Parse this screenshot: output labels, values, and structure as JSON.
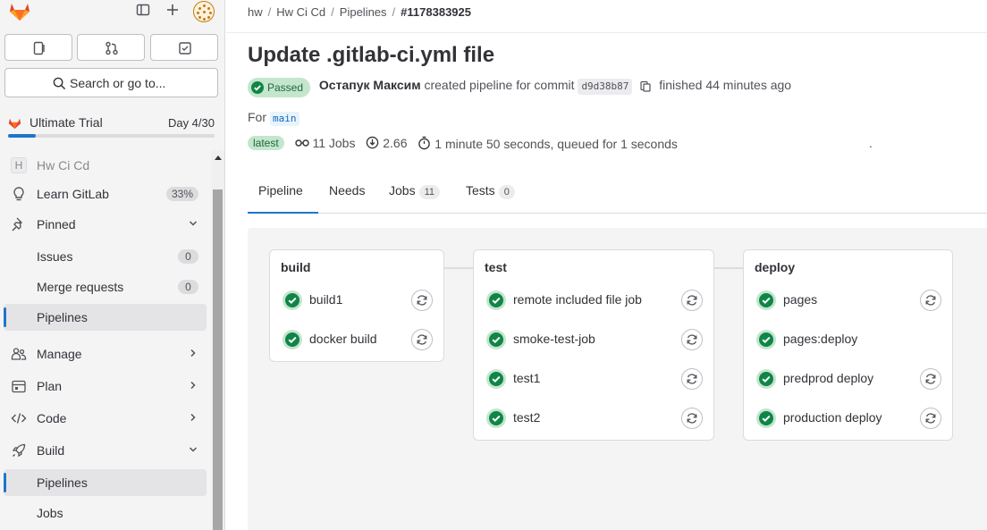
{
  "sidebar": {
    "quick_actions": [
      {
        "name": "issues-quick-action",
        "icon": "issues-icon"
      },
      {
        "name": "merge-requests-quick-action",
        "icon": "merge-request-icon"
      },
      {
        "name": "todo-quick-action",
        "icon": "todo-icon"
      }
    ],
    "search_label": "Search or go to...",
    "trial": {
      "label": "Ultimate Trial",
      "day": "Day 4/30",
      "progress_fraction": 0.133
    },
    "project": {
      "initial": "H",
      "label": "Hw Ci Cd"
    },
    "items": [
      {
        "label": "Learn GitLab",
        "count": "33%"
      },
      {
        "label": "Pinned"
      },
      {
        "label": "Issues",
        "count": "0"
      },
      {
        "label": "Merge requests",
        "count": "0"
      },
      {
        "label": "Pipelines"
      },
      {
        "label": "Manage"
      },
      {
        "label": "Plan"
      },
      {
        "label": "Code"
      },
      {
        "label": "Build"
      },
      {
        "label": "Pipelines"
      },
      {
        "label": "Jobs"
      }
    ]
  },
  "breadcrumb": {
    "items": [
      "hw",
      "Hw Ci Cd",
      "Pipelines"
    ],
    "current": "#1178383925"
  },
  "pipeline": {
    "title": "Update .gitlab-ci.yml file",
    "status": "Passed",
    "author": "Остапук Максим",
    "created_text": "created pipeline for commit",
    "commit_sha": "d9d38b87",
    "finished_text": "finished 44 minutes ago",
    "for_label": "For",
    "branch": "main",
    "latest_badge": "latest",
    "jobs_count": "11 Jobs",
    "compute": "2.66",
    "duration": "1 minute 50 seconds, queued for 1 seconds",
    "dot": "."
  },
  "tabs": [
    {
      "label": "Pipeline"
    },
    {
      "label": "Needs"
    },
    {
      "label": "Jobs",
      "count": "11"
    },
    {
      "label": "Tests",
      "count": "0"
    }
  ],
  "stages": [
    {
      "name": "build",
      "jobs": [
        {
          "name": "build1"
        },
        {
          "name": "docker build"
        }
      ]
    },
    {
      "name": "test",
      "jobs": [
        {
          "name": "remote included file job"
        },
        {
          "name": "smoke-test-job"
        },
        {
          "name": "test1"
        },
        {
          "name": "test2"
        }
      ]
    },
    {
      "name": "deploy",
      "jobs": [
        {
          "name": "pages",
          "retry": true
        },
        {
          "name": "pages:deploy",
          "retry": false
        },
        {
          "name": "predprod deploy",
          "retry": true
        },
        {
          "name": "production deploy",
          "retry": true
        }
      ]
    }
  ],
  "colors": {
    "success": "#108548",
    "success_bg": "#c3e6cd",
    "accent": "#1f75cb"
  }
}
